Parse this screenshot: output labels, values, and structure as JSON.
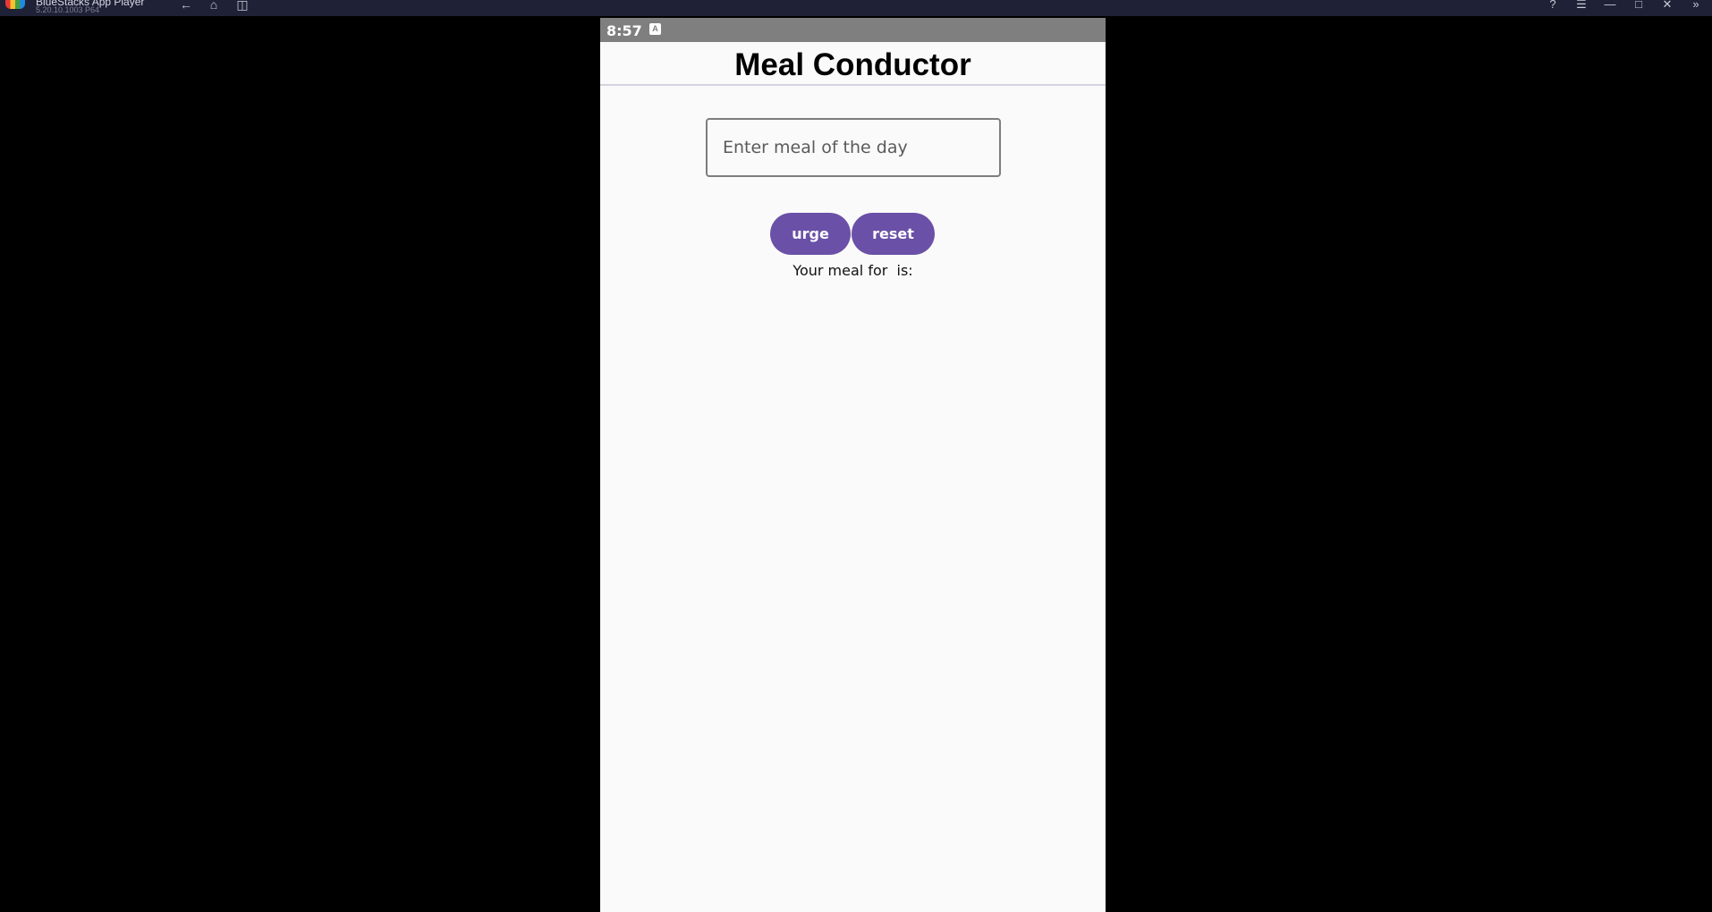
{
  "host": {
    "title": "BlueStacks App Player",
    "version": "5.20.10.1003 P64",
    "nav_icons": [
      "back-icon",
      "home-icon",
      "recent-apps-icon"
    ],
    "window_icons": [
      "help-icon",
      "menu-icon",
      "minimize-icon",
      "maximize-icon",
      "close-icon",
      "sidebar-toggle-icon"
    ]
  },
  "status_bar": {
    "time": "8:57",
    "notification_icon": "A"
  },
  "app": {
    "title": "Meal Conductor",
    "input": {
      "value": "",
      "placeholder": "Enter meal of the day"
    },
    "buttons": {
      "urge_label": "urge",
      "reset_label": "reset"
    },
    "result_text": "Your meal for  is:"
  },
  "colors": {
    "accent": "#6a50a7",
    "status_bar": "#7f7f7f",
    "host_bar": "#1f2136",
    "app_background": "#fafafa"
  }
}
